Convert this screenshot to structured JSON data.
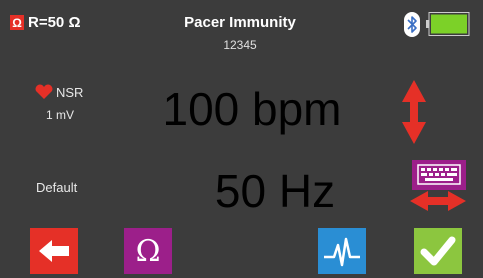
{
  "header": {
    "resistance_symbol": "Ω",
    "resistance": "R=50 Ω",
    "title": "Pacer Immunity",
    "subtitle": "12345",
    "bluetooth_icon": "bluetooth-icon",
    "battery_icon": "battery-icon",
    "battery_level": 1.0
  },
  "left": {
    "rhythm_icon": "heart-icon",
    "rhythm": "NSR",
    "amplitude": "1 mV",
    "waveform": "Default"
  },
  "main": {
    "rate": "100 bpm",
    "frequency": "50 Hz"
  },
  "controls": {
    "updown_icon": "up-down-arrows-icon",
    "keyboard_icon": "keyboard-icon",
    "leftright_icon": "left-right-arrows-icon"
  },
  "buttons": {
    "back_icon": "back-arrow-icon",
    "ohm_label": "Ω",
    "waveform_icon": "waveform-icon",
    "confirm_icon": "check-icon"
  },
  "colors": {
    "background": "#3c3c3c",
    "red": "#e53027",
    "purple": "#9c1f8a",
    "blue": "#2a8ed4",
    "green": "#8cc63f"
  }
}
